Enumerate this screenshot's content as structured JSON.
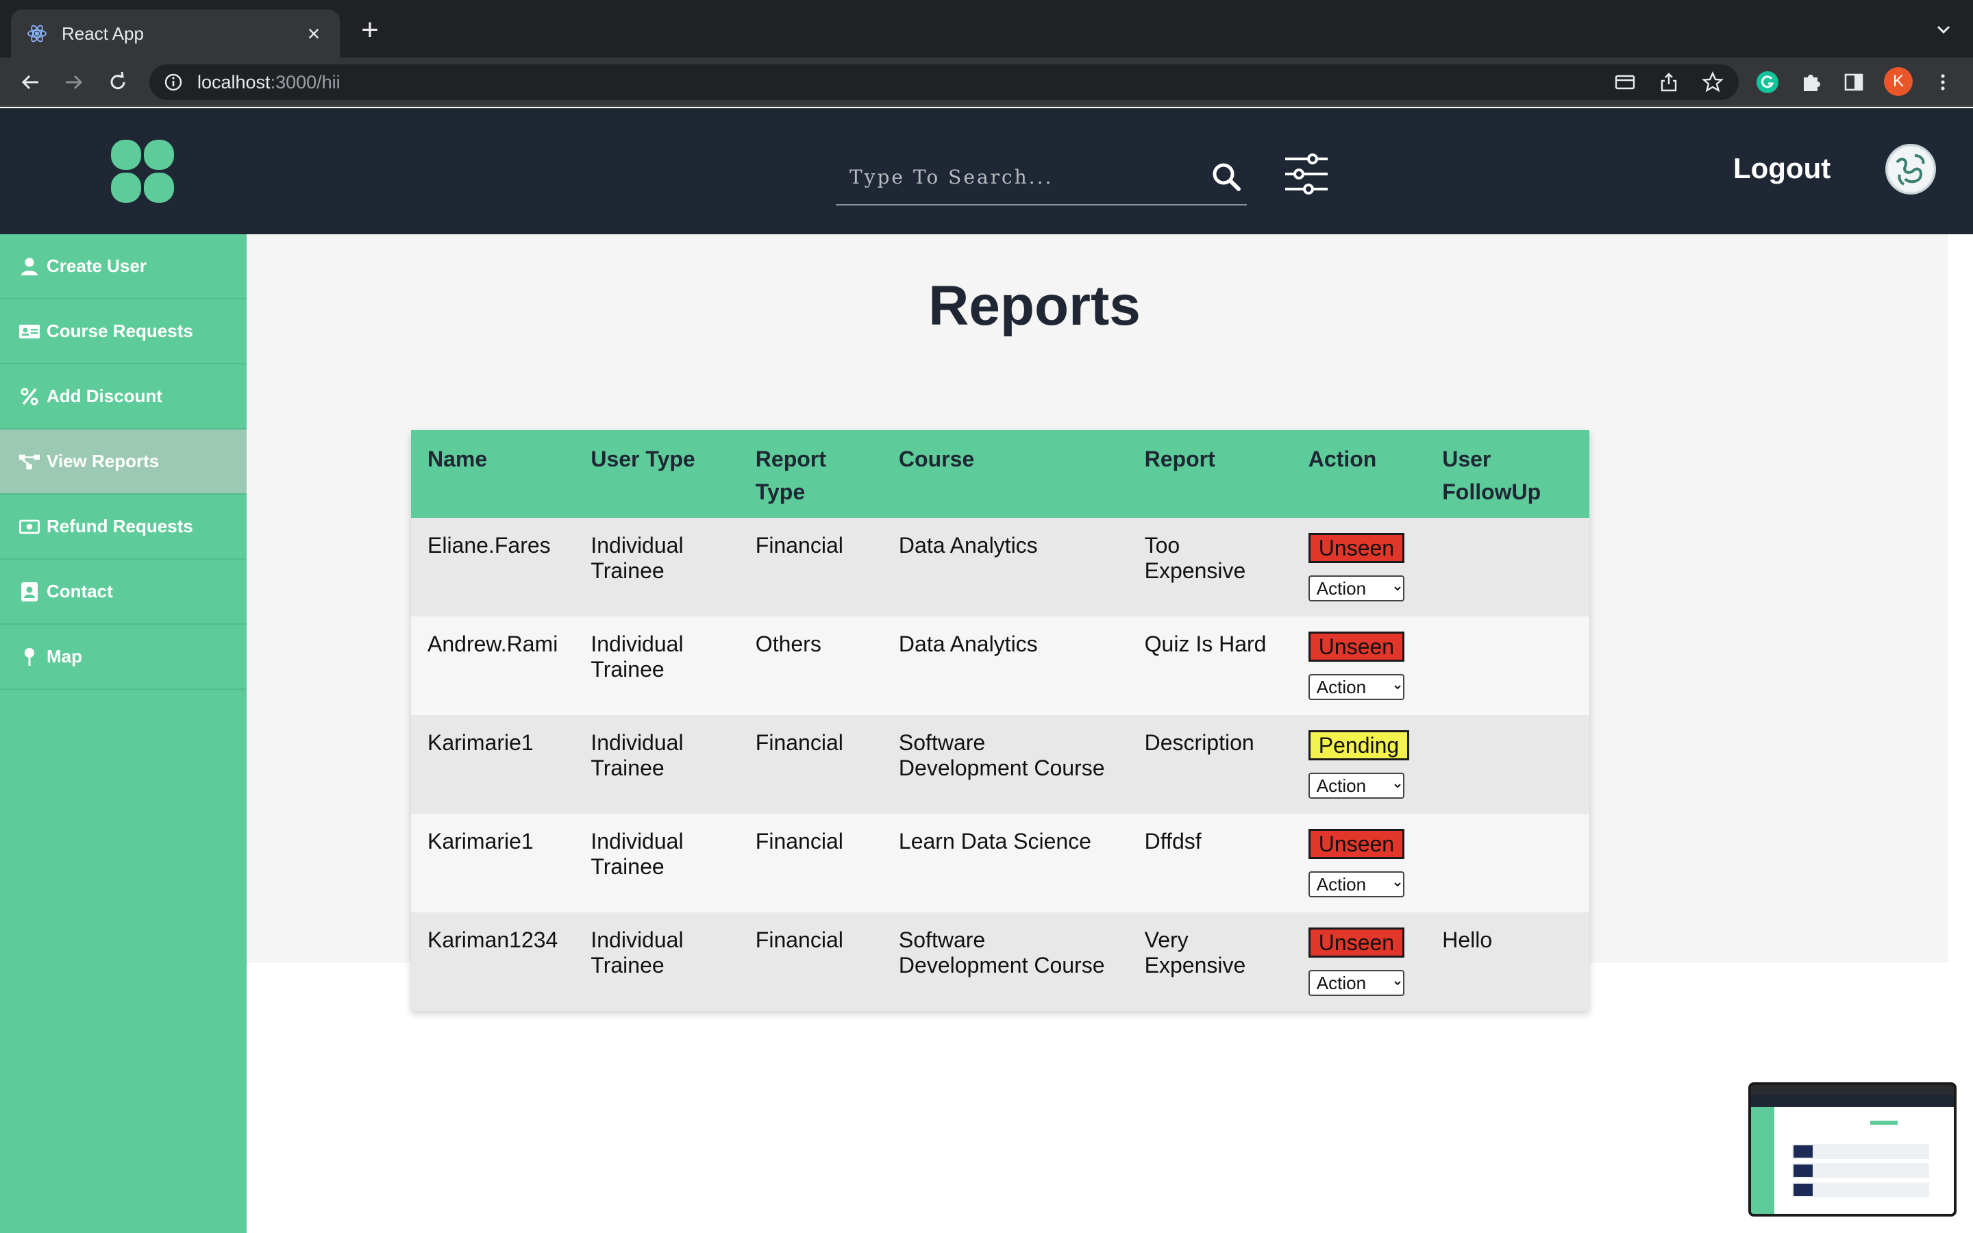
{
  "browser": {
    "tab_title": "React App",
    "url_host": "localhost",
    "url_path": ":3000/hii",
    "profile_initial": "K"
  },
  "header": {
    "search_placeholder": "Type To Search...",
    "logout_label": "Logout"
  },
  "sidebar": {
    "items": [
      {
        "label": "Create User",
        "icon": "user-icon"
      },
      {
        "label": "Course Requests",
        "icon": "id-card-icon"
      },
      {
        "label": "Add Discount",
        "icon": "percent-icon"
      },
      {
        "label": "View Reports",
        "icon": "diagram-icon",
        "active": true
      },
      {
        "label": "Refund Requests",
        "icon": "money-icon"
      },
      {
        "label": "Contact",
        "icon": "contact-icon"
      },
      {
        "label": "Map",
        "icon": "pin-icon"
      }
    ]
  },
  "main": {
    "title": "Reports",
    "columns": [
      "Name",
      "User Type",
      "Report Type",
      "Course",
      "Report",
      "Action",
      "User FollowUp"
    ],
    "rows": [
      {
        "name": "Eliane.Fares",
        "user_type": "Individual Trainee",
        "report_type": "Financial",
        "course": "Data Analytics",
        "report": "Too Expensive",
        "status": "Unseen",
        "action": "Action",
        "followup": ""
      },
      {
        "name": "Andrew.Rami",
        "user_type": "Individual Trainee",
        "report_type": "Others",
        "course": "Data Analytics",
        "report": "Quiz Is Hard",
        "status": "Unseen",
        "action": "Action",
        "followup": ""
      },
      {
        "name": "Karimarie1",
        "user_type": "Individual Trainee",
        "report_type": "Financial",
        "course": "Software Development Course",
        "report": "Description",
        "status": "Pending",
        "action": "Action",
        "followup": ""
      },
      {
        "name": "Karimarie1",
        "user_type": "Individual Trainee",
        "report_type": "Financial",
        "course": "Learn Data Science",
        "report": "Dffdsf",
        "status": "Unseen",
        "action": "Action",
        "followup": ""
      },
      {
        "name": "Kariman1234",
        "user_type": "Individual Trainee",
        "report_type": "Financial",
        "course": "Software Development Course",
        "report": "Very Expensive",
        "status": "Unseen",
        "action": "Action",
        "followup": "Hello"
      }
    ]
  },
  "colors": {
    "header_bg": "#1e2733",
    "sidebar_bg": "#5ecc9a",
    "table_header_bg": "#5ecc9a",
    "status_unseen": "#e2362a",
    "status_pending": "#f4f24c",
    "report_type_text": "#2f8a6a"
  }
}
